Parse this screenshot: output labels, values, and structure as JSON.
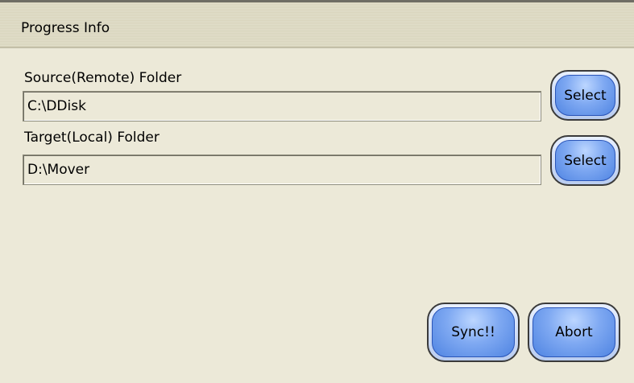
{
  "panel": {
    "title": "Progress Info"
  },
  "source": {
    "label": "Source(Remote) Folder",
    "value": "C:\\DDisk",
    "select_label": "Select"
  },
  "target": {
    "label": "Target(Local) Folder",
    "value": "D:\\Mover",
    "select_label": "Select"
  },
  "actions": {
    "sync_label": "Sync!!",
    "abort_label": "Abort"
  }
}
